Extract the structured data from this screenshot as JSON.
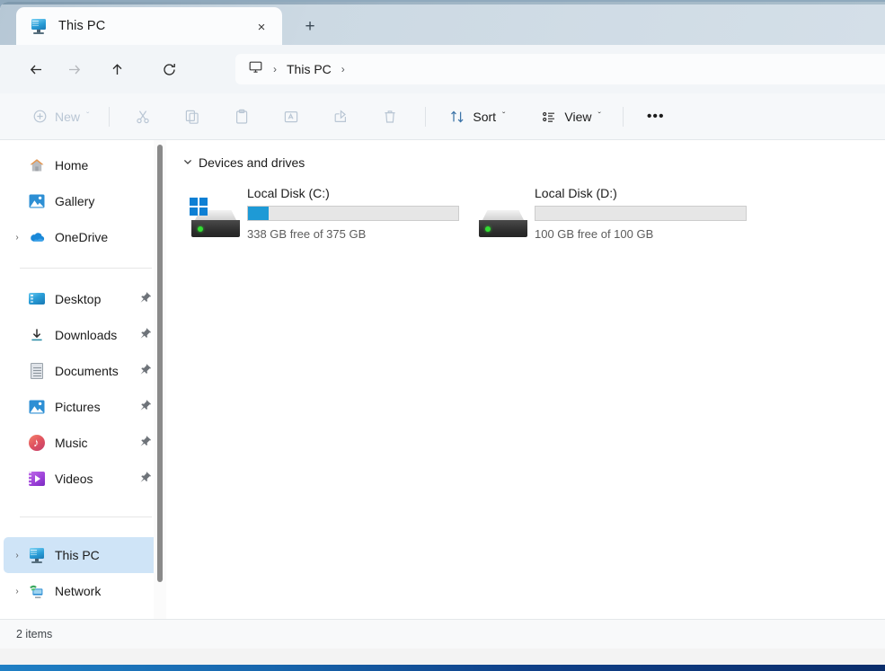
{
  "window": {
    "tab": {
      "title": "This PC",
      "icon": "monitor-icon",
      "close_label": "×"
    },
    "new_tab_label": "+"
  },
  "nav": {
    "back": "back-arrow-icon",
    "forward": "forward-arrow-icon",
    "up": "up-arrow-icon",
    "refresh": "refresh-icon",
    "address": {
      "root_icon": "monitor-icon",
      "separator": "›",
      "path": "This PC",
      "trailing_separator": "›"
    }
  },
  "toolbar": {
    "new_label": "New",
    "new_chevron": "ˇ",
    "cut_label": "cut-icon",
    "copy_label": "copy-icon",
    "paste_label": "paste-icon",
    "rename_label": "rename-icon",
    "share_label": "share-icon",
    "delete_label": "delete-icon",
    "sort_label": "Sort",
    "sort_chevron": "ˇ",
    "view_label": "View",
    "view_chevron": "ˇ",
    "more_label": "•••"
  },
  "sidebar": {
    "items": [
      {
        "label": "Home",
        "icon": "home-icon",
        "chevron": "",
        "pinned": false,
        "selected": false
      },
      {
        "label": "Gallery",
        "icon": "gallery-icon",
        "chevron": "",
        "pinned": false,
        "selected": false
      },
      {
        "label": "OneDrive",
        "icon": "onedrive-icon",
        "chevron": "›",
        "pinned": false,
        "selected": false
      }
    ],
    "pinned_items": [
      {
        "label": "Desktop",
        "icon": "desktop-icon",
        "chevron": "",
        "pinned": true,
        "selected": false
      },
      {
        "label": "Downloads",
        "icon": "downloads-icon",
        "chevron": "",
        "pinned": true,
        "selected": false
      },
      {
        "label": "Documents",
        "icon": "documents-icon",
        "chevron": "",
        "pinned": true,
        "selected": false
      },
      {
        "label": "Pictures",
        "icon": "pictures-icon",
        "chevron": "",
        "pinned": true,
        "selected": false
      },
      {
        "label": "Music",
        "icon": "music-icon",
        "chevron": "",
        "pinned": true,
        "selected": false
      },
      {
        "label": "Videos",
        "icon": "videos-icon",
        "chevron": "",
        "pinned": true,
        "selected": false
      }
    ],
    "system_items": [
      {
        "label": "This PC",
        "icon": "thispc-icon",
        "chevron": "›",
        "pinned": false,
        "selected": true
      },
      {
        "label": "Network",
        "icon": "network-icon",
        "chevron": "›",
        "pinned": false,
        "selected": false
      }
    ]
  },
  "content": {
    "group_title": "Devices and drives",
    "group_chevron": "⌄",
    "drives": [
      {
        "name": "Local Disk (C:)",
        "capacity_text": "338 GB free of 375 GB",
        "free_gb": 338,
        "total_gb": 375,
        "used_percent": 10,
        "has_windows_badge": true,
        "bar_color": "#1e9ad6"
      },
      {
        "name": "Local Disk (D:)",
        "capacity_text": "100 GB free of 100 GB",
        "free_gb": 100,
        "total_gb": 100,
        "used_percent": 0,
        "has_windows_badge": false,
        "bar_color": "#1e9ad6"
      }
    ]
  },
  "statusbar": {
    "item_count_text": "2 items"
  },
  "colors": {
    "accent": "#1e9ad6",
    "selection": "#cfe4f7",
    "titlebar": "#ccd9e3",
    "disabled_icon": "#b9c6d4"
  }
}
